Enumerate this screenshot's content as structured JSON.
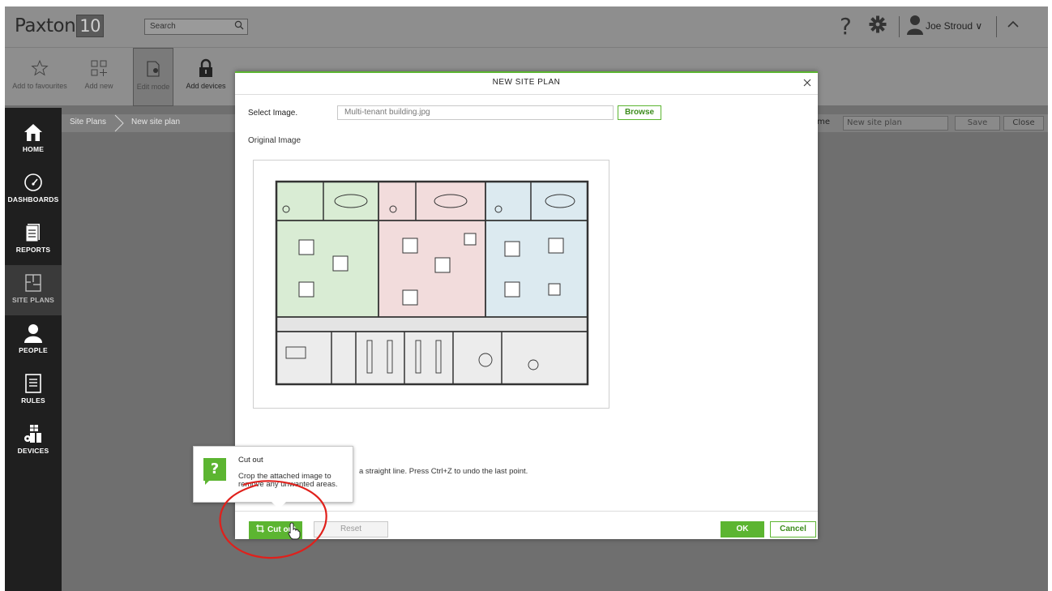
{
  "app": {
    "logo_text": "Paxton",
    "logo_badge": "10",
    "search_placeholder": "Search",
    "user_name": "Joe Stroud ∨"
  },
  "toolbar": {
    "items": [
      {
        "label": "Add to favourites",
        "icon": "star-icon"
      },
      {
        "label": "Add new",
        "icon": "add-new-icon"
      },
      {
        "label": "Edit mode",
        "icon": "edit-mode-icon"
      },
      {
        "label": "Add devices",
        "icon": "lock-icon"
      }
    ]
  },
  "breadcrumb": {
    "items": [
      "Site Plans",
      "New site plan"
    ],
    "name_label": "ame",
    "name_value": "New site plan",
    "save_label": "Save",
    "close_label": "Close"
  },
  "sidebar": {
    "items": [
      {
        "label": "HOME",
        "icon": "home-icon",
        "active": false
      },
      {
        "label": "DASHBOARDS",
        "icon": "dashboard-gauge-icon",
        "active": false
      },
      {
        "label": "REPORTS",
        "icon": "reports-icon",
        "active": false
      },
      {
        "label": "SITE PLANS",
        "icon": "site-plans-icon",
        "active": true
      },
      {
        "label": "PEOPLE",
        "icon": "person-icon",
        "active": false
      },
      {
        "label": "RULES",
        "icon": "rules-icon",
        "active": false
      },
      {
        "label": "DEVICES",
        "icon": "devices-icon",
        "active": false
      }
    ]
  },
  "dialog": {
    "title": "NEW SITE PLAN",
    "select_image_label": "Select Image.",
    "select_image_value": "Multi-tenant building.jpg",
    "browse_label": "Browse",
    "original_image_label": "Original Image",
    "hint_text": "a straight line. Press Ctrl+Z to undo the last point.",
    "cutout_label": "Cut out",
    "reset_label": "Reset",
    "ok_label": "OK",
    "cancel_label": "Cancel"
  },
  "tooltip": {
    "icon_glyph": "?",
    "title": "Cut out",
    "body": "Crop the attached image to remove any unwanted areas."
  },
  "colors": {
    "accent_green": "#5cb531",
    "zone_green": "#d9ecd4",
    "zone_pink": "#f2dcdc",
    "zone_blue": "#dceaf0",
    "annotation_red": "#e0201b"
  }
}
